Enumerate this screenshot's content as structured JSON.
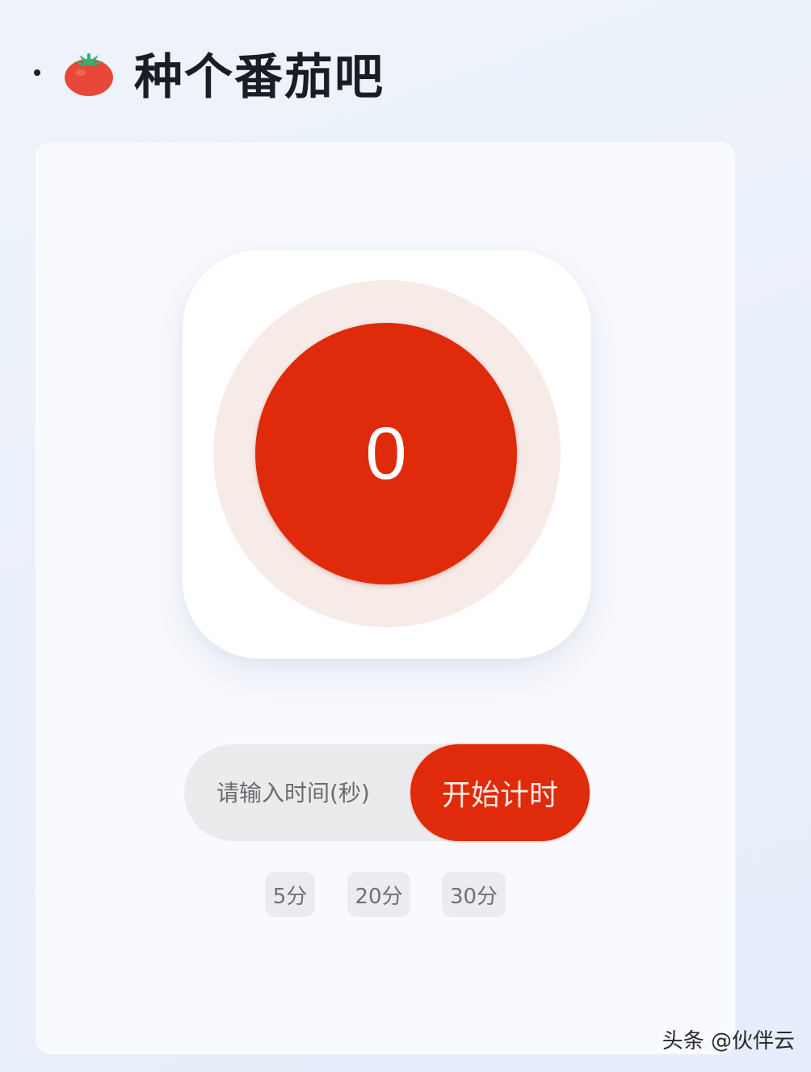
{
  "header": {
    "icon": "tomato-icon",
    "title": "种个番茄吧"
  },
  "timer": {
    "value": "0",
    "accent_color": "#df2a0c"
  },
  "controls": {
    "input_placeholder": "请输入时间(秒)",
    "start_label": "开始计时",
    "presets": [
      "5分",
      "20分",
      "30分"
    ]
  },
  "watermark": "头条 @伙伴云"
}
